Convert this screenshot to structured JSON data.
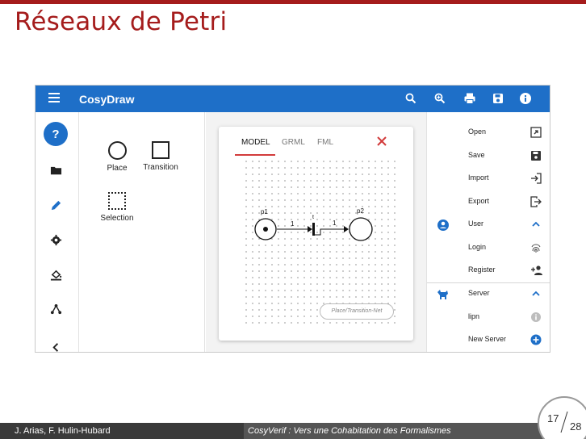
{
  "slide": {
    "title": "Réseaux de Petri",
    "footer_authors": "J. Arias, F. Hulin-Hubard",
    "footer_talk": "CosyVerif : Vers une Cohabitation des Formalismes",
    "page_current": "17",
    "page_total": "28"
  },
  "app": {
    "title": "CosyDraw",
    "toolbar_icons": [
      "search-icon",
      "zoom-in-icon",
      "print-icon",
      "save-icon",
      "info-icon"
    ],
    "accent": "#1e6fc8",
    "rail": [
      "help-icon",
      "folder-icon",
      "pencil-icon",
      "gear-icon",
      "paint-bucket-icon",
      "graph-icon",
      "chevron-left-icon"
    ],
    "help_glyph": "?",
    "palette": {
      "place": "Place",
      "transition": "Transition",
      "selection": "Selection"
    },
    "tabs": [
      "MODEL",
      "GRML",
      "FML"
    ],
    "net": {
      "place1": "p1",
      "place2": "p2",
      "transition": "t",
      "arc1_weight": "1",
      "arc2_weight": "1",
      "badge": "Place/Transition-Net"
    },
    "menu": {
      "open": "Open",
      "save": "Save",
      "import": "Import",
      "export": "Export",
      "user": "User",
      "login": "Login",
      "register": "Register",
      "server": "Server",
      "lipn": "lipn",
      "new_server": "New Server"
    }
  }
}
